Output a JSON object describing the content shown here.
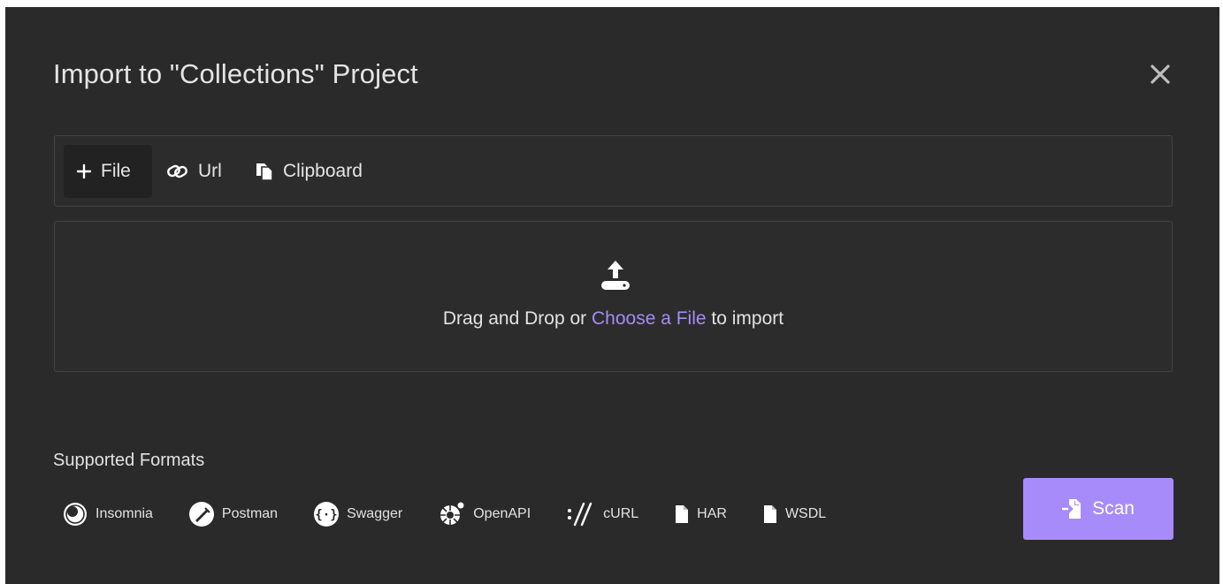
{
  "dialog": {
    "title": "Import to \"Collections\" Project",
    "close_icon": "close-icon"
  },
  "tabs": [
    {
      "label": "File",
      "icon": "plus-icon",
      "active": true
    },
    {
      "label": "Url",
      "icon": "link-icon",
      "active": false
    },
    {
      "label": "Clipboard",
      "icon": "clipboard-icon",
      "active": false
    }
  ],
  "dropzone": {
    "icon": "upload-icon",
    "text_before": "Drag and Drop or",
    "link_text": "Choose a File",
    "text_after": "to import"
  },
  "formats": {
    "label": "Supported Formats",
    "items": [
      {
        "name": "Insomnia",
        "icon": "insomnia-icon"
      },
      {
        "name": "Postman",
        "icon": "postman-icon"
      },
      {
        "name": "Swagger",
        "icon": "swagger-icon"
      },
      {
        "name": "OpenAPI",
        "icon": "openapi-icon"
      },
      {
        "name": "cURL",
        "icon": "curl-icon"
      },
      {
        "name": "HAR",
        "icon": "file-icon"
      },
      {
        "name": "WSDL",
        "icon": "file-icon"
      }
    ]
  },
  "scan_button": {
    "label": "Scan",
    "icon": "import-icon"
  },
  "colors": {
    "background": "#2a2a2a",
    "accent": "#a78bfa",
    "link": "#a48cf5",
    "text": "#e4e4e4"
  }
}
